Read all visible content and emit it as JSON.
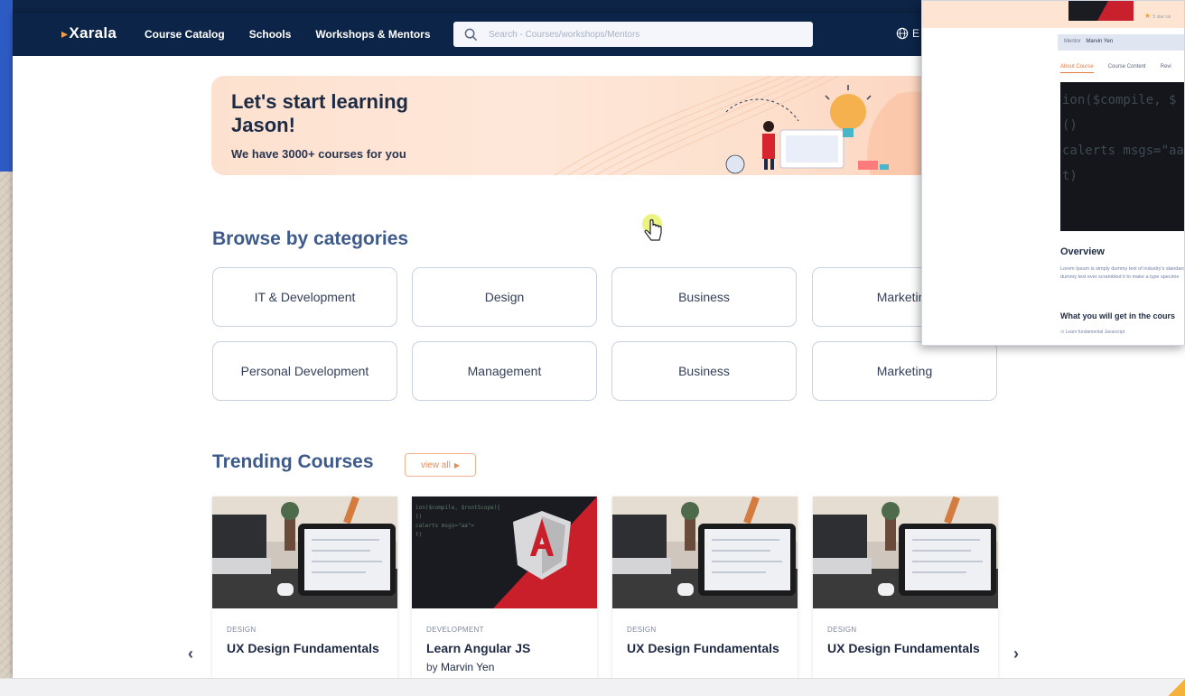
{
  "nav": {
    "logo": "Xarala",
    "links": [
      "Course Catalog",
      "Schools",
      "Workshops & Mentors"
    ],
    "search_placeholder": "Search - Courses/workshops/Mentors",
    "language": "E"
  },
  "banner": {
    "title": "Let's start learning Jason!",
    "subtitle": "We have 3000+ courses for you"
  },
  "categories": {
    "title": "Browse by categories",
    "items": [
      "IT & Development",
      "Design",
      "Business",
      "Marketing",
      "Personal Development",
      "Management",
      "Business",
      "Marketing"
    ]
  },
  "trending": {
    "title": "Trending Courses",
    "view_all": "view all",
    "courses": [
      {
        "category": "DESIGN",
        "title": "UX Design Fundamentals",
        "by": ""
      },
      {
        "category": "DEVELOPMENT",
        "title": "Learn Angular JS",
        "by_label": "by",
        "author": "Marvin Yen"
      },
      {
        "category": "DESIGN",
        "title": "UX Design Fundamentals"
      },
      {
        "category": "DESIGN",
        "title": "UX Design Fundamentals"
      }
    ]
  },
  "overlay": {
    "stars_text": "5 star rat",
    "mentor_label": "Mentor",
    "mentor_name": "Marvin Yen",
    "tabs": [
      "About Course",
      "Course Content",
      "Revi"
    ],
    "code_lines": [
      "ion($compile, $",
      "()",
      "calerts msgs=\"aa",
      "t)"
    ],
    "overview_title": "Overview",
    "overview_text": "Lorem Ipsum is simply dummy text of industry's standard dummy text ever scrambled it to make a type specime",
    "get_title": "What you will get in the cours",
    "get_item": "Learn fundamental Javascript"
  },
  "colors": {
    "navy": "#0c2447",
    "accent": "#e88a56",
    "heading_blue": "#3e5a8a"
  }
}
